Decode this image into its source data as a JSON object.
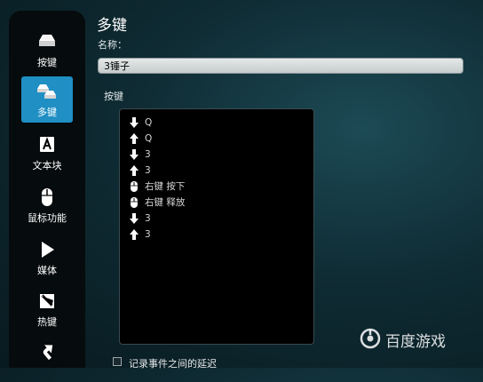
{
  "sidebar": {
    "items": [
      {
        "label": "按键",
        "icon": "keycap-icon",
        "active": false
      },
      {
        "label": "多键",
        "icon": "multikey-icon",
        "active": true
      },
      {
        "label": "文本块",
        "icon": "text-block-icon",
        "active": false
      },
      {
        "label": "鼠标功能",
        "icon": "mouse-icon",
        "active": false
      },
      {
        "label": "媒体",
        "icon": "play-icon",
        "active": false
      },
      {
        "label": "热键",
        "icon": "hotkey-icon",
        "active": false
      },
      {
        "label": "",
        "icon": "shortcut-arrow-icon",
        "active": false
      }
    ]
  },
  "main": {
    "title": "多键",
    "name_label": "名称：",
    "name_value": "3锤子",
    "keys_label": "按键",
    "key_events": [
      {
        "icon": "arrow-down-icon",
        "text": "Q"
      },
      {
        "icon": "arrow-up-icon",
        "text": "Q"
      },
      {
        "icon": "arrow-down-icon",
        "text": "3"
      },
      {
        "icon": "arrow-up-icon",
        "text": "3"
      },
      {
        "icon": "mouse-icon",
        "text": "右键 按下"
      },
      {
        "icon": "mouse-icon",
        "text": "右键 释放"
      },
      {
        "icon": "arrow-down-icon",
        "text": "3"
      },
      {
        "icon": "arrow-up-icon",
        "text": "3"
      }
    ],
    "record_delay_label": "记录事件之间的延迟",
    "record_delay_checked": false
  },
  "watermark": {
    "text": "百度游戏",
    "icon": "baidu-games-logo-icon"
  },
  "colors": {
    "accent": "#1f8fc4",
    "sidebar_bg": "#060b0d",
    "list_bg": "#000000"
  }
}
